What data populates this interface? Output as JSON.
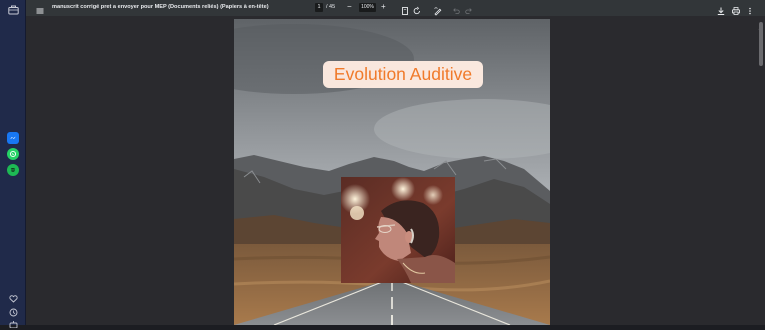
{
  "toolbar": {
    "document_title": "manuscrit corrigé pret a envoyer pour MEP (Documents reliés) (Papiers à en-tête)",
    "page_current": "1",
    "page_total": "/ 45",
    "zoom_out_label": "−",
    "zoom_level": "100%",
    "zoom_in_label": "+"
  },
  "page_content": {
    "title": "Evolution Auditive"
  },
  "icons": {
    "sidebar": [
      "briefcase-icon",
      "messenger-icon",
      "whatsapp-icon",
      "spotify-icon",
      "heart-icon",
      "clock-icon",
      "more-icon"
    ],
    "toolbar": [
      "menu-icon",
      "fit-page-icon",
      "rotate-icon",
      "draw-icon",
      "undo-icon",
      "redo-icon",
      "download-icon",
      "print-icon",
      "more-vert-icon"
    ]
  },
  "colors": {
    "sidebar_bg": "#202a4a",
    "toolbar_bg": "#323639",
    "viewer_bg": "#2a2a2e",
    "title_text": "#f07a2a",
    "title_box": "#ffece2"
  }
}
